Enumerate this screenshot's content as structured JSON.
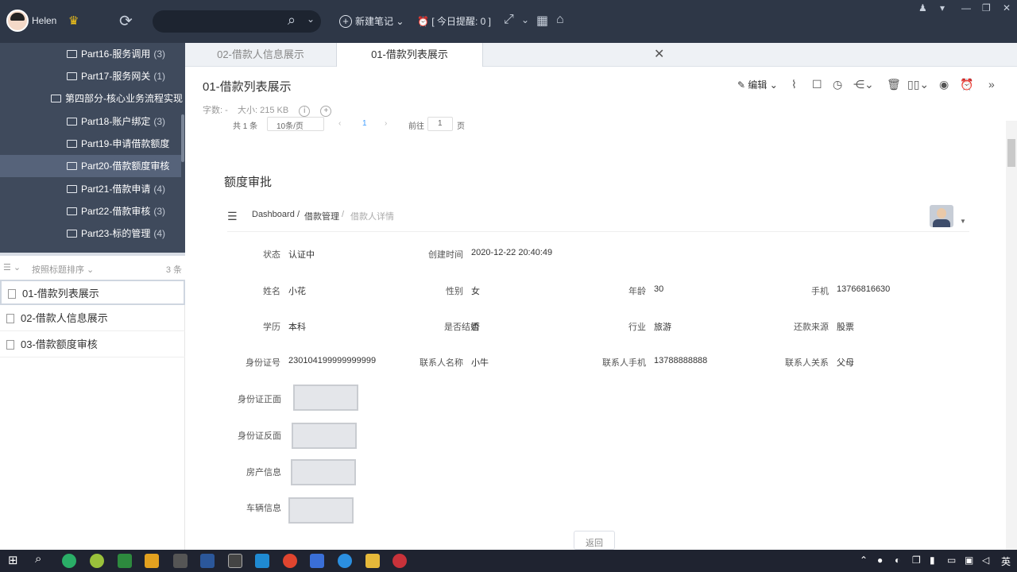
{
  "app": {
    "username": "Helen",
    "new_note_label": "新建笔记",
    "reminder_label": "[ 今日提醒: 0 ]",
    "colors": {
      "topbar": "#2e3747",
      "sidebar": "#3f4a5c",
      "accent": "#4a7bd0"
    }
  },
  "sidebar": {
    "tree": [
      {
        "label": "Part16-服务调用",
        "count": "(3)"
      },
      {
        "label": "Part17-服务网关",
        "count": "(1)"
      },
      {
        "label": "第四部分-核心业务流程实现",
        "count": ""
      },
      {
        "label": "Part18-账户绑定",
        "count": "(3)"
      },
      {
        "label": "Part19-申请借款额度",
        "count": ""
      },
      {
        "label": "Part20-借款额度审核",
        "count": ""
      },
      {
        "label": "Part21-借款申请",
        "count": "(4)"
      },
      {
        "label": "Part22-借款审核",
        "count": "(3)"
      },
      {
        "label": "Part23-标的管理",
        "count": "(4)"
      }
    ],
    "sort_label": "按照标题排序",
    "note_count": "3 条",
    "notes": [
      {
        "label": "01-借款列表展示"
      },
      {
        "label": "02-借款人信息展示"
      },
      {
        "label": "03-借款额度审核"
      }
    ]
  },
  "tabs": [
    {
      "label": "02-借款人信息展示"
    },
    {
      "label": "01-借款列表展示"
    }
  ],
  "note": {
    "title": "01-借款列表展示",
    "word_count": "字数: -",
    "size": "大小: 215 KB",
    "edit_label": "编辑"
  },
  "pager": {
    "total": "共 1 条",
    "per_page": "10条/页",
    "current": "1",
    "goto_label": "前往",
    "goto_value": "1",
    "page_suffix": "页"
  },
  "section_title": "额度审批",
  "breadcrumb": [
    "Dashboard",
    "/",
    "借款管理",
    "/",
    "借款人详情"
  ],
  "details": {
    "status_label": "状态",
    "status": "认证中",
    "created_label": "创建时间",
    "created": "2020-12-22 20:40:49",
    "name_label": "姓名",
    "name": "小花",
    "gender_label": "性别",
    "gender": "女",
    "age_label": "年龄",
    "age": "30",
    "phone_label": "手机",
    "phone": "13766816630",
    "edu_label": "学历",
    "edu": "本科",
    "married_label": "是否结婚",
    "married": "否",
    "industry_label": "行业",
    "industry": "旅游",
    "repay_label": "还款来源",
    "repay": "股票",
    "idno_label": "身份证号",
    "idno": "230104199999999999",
    "contact_label": "联系人名称",
    "contact": "小牛",
    "contact_phone_label": "联系人手机",
    "contact_phone": "13788888888",
    "relation_label": "联系人关系",
    "relation": "父母",
    "id_front_label": "身份证正面",
    "id_back_label": "身份证反面",
    "house_label": "房产信息",
    "car_label": "车辆信息",
    "back_label": "返回"
  },
  "taskbar": {
    "ime": "英"
  }
}
